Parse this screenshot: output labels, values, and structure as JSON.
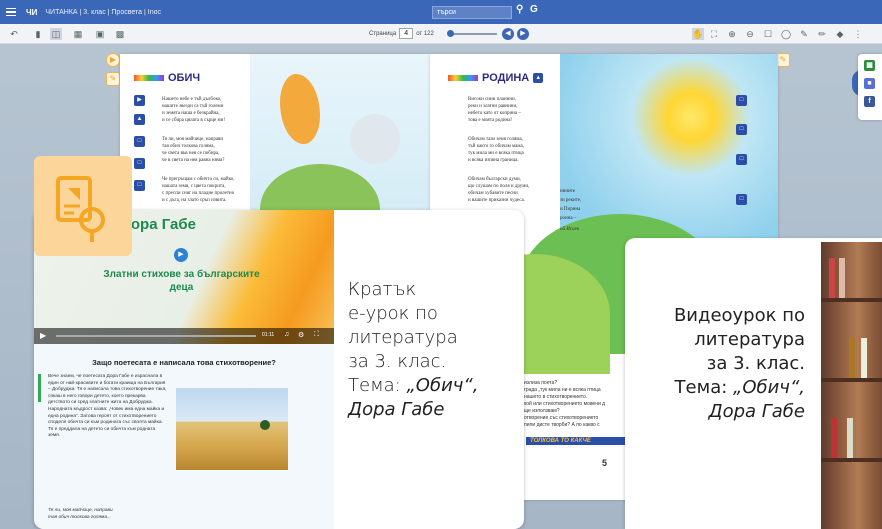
{
  "titlebar": {
    "logo": "ЧИТАНКА",
    "title": "ЧИТАНКА | 3. клас | Просвета | Inoc",
    "search_placeholder": "търси",
    "search_icon": "search-icon",
    "g_label": "G"
  },
  "toolbar": {
    "page_label": "Страница",
    "page_value": "4",
    "page_total": "от 122"
  },
  "left_page": {
    "heading": "ОБИЧ",
    "stanzas": [
      "Нашето небе е тъй дълбоко,\nнашите звезди са тъй големи\nи земята наша е безкрайна,\nи се сбира цялата в сърце ми!",
      "Тя ли, моя майчице, направи\nтая обич толкова голяма,\nче света във нея се побира,\nче в света на нея равна няма?",
      "Че прегръщам с обичта си, майко,\nнашата земя, с цвета покрита,\nс преспи сняг на пладне пролетно\nи с дъга, на злато сръп извита."
    ]
  },
  "right_page": {
    "heading": "РОДИНА",
    "stanzas": [
      "Високи сини планини,\nреки и златни равнини,\nнебето като от коприна –\nтова е моята родина!",
      "Обичам тази земя голяма,\nтъй както го обичам мама,\nтук мила ми е всяка птица\nи всяка изпяна граница.",
      "Обичам български думи,\nщо слушам по поля и друми,\nобичам хубавите песни\nи вашите приказни чудеса."
    ],
    "fragments": [
      "нините",
      "зи реките,",
      "и Пирина",
      "ронна –",
      "ой Исиев"
    ],
    "questions": "излиза поета?\nграда „тук мила ни е всяка птица\nнашето в стихотворението.\nкой или стихотворението мовени д\nще използвам?\nотворение със стихотворението\nпили дисте творби? А по какво с",
    "banner": "ТОЛКОВА ТО КАКЧЕ",
    "page_number": "5"
  },
  "video_card": {
    "video_title": "Дора Габе",
    "video_subtitle": "Златни стихове за българските деца",
    "video_time": "01:11",
    "lesson_title": "Защо поетесата е написала това стихотворение?",
    "lesson_text": "Вече знаем, че поетесата Дора Габе е израснала в един от най-красивите и богати краища на България – Добруджа. Тя е написала това стихотворение така, сякаш в него говори детето, което прекарва детството си сред златните жита на Добруджа.\nНародната мъдрост казва: „Човек има една майка и една родина“. Затова героят от стихотворението споделя обичта си към родината със своята майка. Тя е преддала на детето си обичта към родната земя.",
    "lesson_text2": "Тя ли, моя майчице, направи\nтая обич толкова голяма...",
    "caption_line1": "Кратък",
    "caption_line2": "е-урок по",
    "caption_line3": "литература",
    "caption_line4": "за 3. клас.",
    "caption_line5": "Тема: ",
    "caption_em": "„Обич“,",
    "caption_author": "Дора Габе"
  },
  "right_card": {
    "line1": "Видеоурок по",
    "line2": "литература",
    "line3": "за 3. клас.",
    "line4": "Тема: ",
    "em": "„Обич“,",
    "author": "Дора Габе"
  },
  "colors": {
    "titlebar": "#3a67b8",
    "accent_green": "#1c8a4e",
    "badge": "#fbd59a",
    "yellow": "#f5a623"
  }
}
